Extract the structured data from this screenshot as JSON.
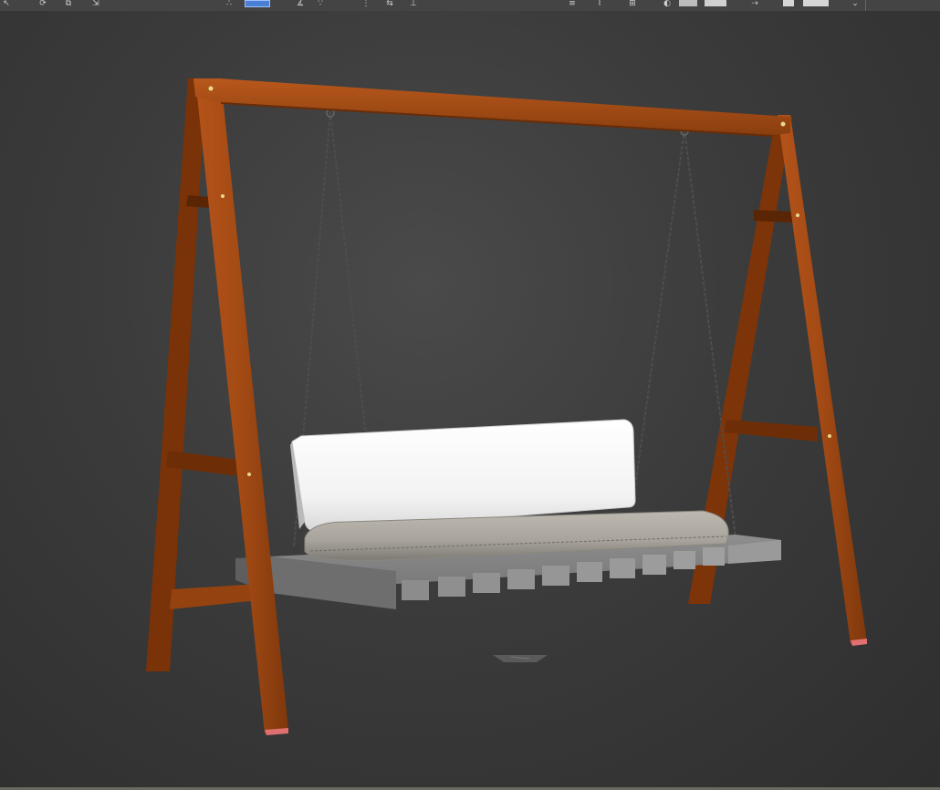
{
  "toolbar": {
    "icons": [
      {
        "name": "select-icon",
        "glyph": "↖"
      },
      {
        "name": "rotate-icon",
        "glyph": "⟳"
      },
      {
        "name": "transform-icon",
        "glyph": "⧉"
      },
      {
        "name": "active-tool-icon",
        "glyph": "▣",
        "active": true
      },
      {
        "name": "snap-icon",
        "glyph": "∴"
      },
      {
        "name": "angle-snap-icon",
        "glyph": "∡"
      },
      {
        "name": "mirror-icon",
        "glyph": "⇆"
      },
      {
        "name": "align-icon",
        "glyph": "⊥"
      },
      {
        "name": "layer-icon",
        "glyph": "≡"
      },
      {
        "name": "curve-editor-icon",
        "glyph": "⌇"
      },
      {
        "name": "schematic-icon",
        "glyph": "⊞"
      },
      {
        "name": "material-editor-icon",
        "glyph": "◐"
      },
      {
        "name": "render-setup-icon",
        "glyph": "▭"
      },
      {
        "name": "render-icon",
        "glyph": "▮"
      }
    ],
    "accent_color": "#4a7fd4"
  },
  "viewport": {
    "background_color": "#3a3a3a",
    "object": "porch-swing-model",
    "colors": {
      "wood": "#a34a14",
      "wood_dark": "#7a3208",
      "cushion_back": "#f2f2f2",
      "cushion_seat": "#a8a49c",
      "platform": "#8c8c8c",
      "chain": "#555555"
    }
  }
}
